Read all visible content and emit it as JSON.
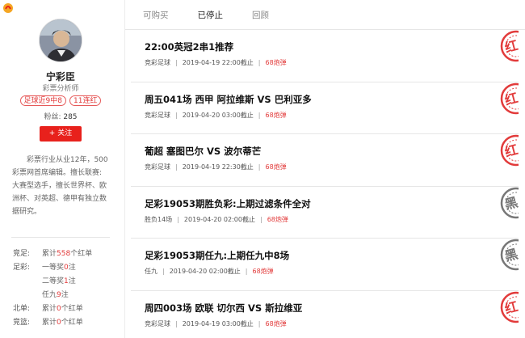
{
  "tabs": [
    {
      "label": "可购买"
    },
    {
      "label": "已停止"
    },
    {
      "label": "回顾"
    }
  ],
  "profile": {
    "name": "宁彩臣",
    "role": "彩票分析师",
    "badges": [
      "足球近9中8",
      "11连红"
    ],
    "fans_label": "粉丝:",
    "fans_count": "285",
    "follow_label": "+ 关注",
    "bio": "彩票行业从业12年，500彩票网首席编辑。擅长联赛:大赛型选手，擅长世界杯、欧洲杯、对英超、德甲有独立数据研究。"
  },
  "stats": [
    {
      "label": "竞足:",
      "text_pre": "累计 ",
      "num": "558",
      "text_post": " 个红单"
    },
    {
      "label": "足彩:",
      "text_pre": "一等奖 ",
      "num": "0",
      "text_post": " 注"
    },
    {
      "label": "",
      "text_pre": "二等奖 ",
      "num": "1",
      "text_post": " 注"
    },
    {
      "label": "",
      "text_pre": "任九 ",
      "num": "9",
      "text_post": " 注"
    },
    {
      "label": "北单:",
      "text_pre": "累计 ",
      "num": "0",
      "text_post": " 个红单"
    },
    {
      "label": "竞篮:",
      "text_pre": "累计 ",
      "num": "0",
      "text_post": " 个红单"
    }
  ],
  "colors": {
    "accent": "#e8211c",
    "red_stamp": "#e23b3b",
    "black_stamp": "#777777"
  },
  "items": [
    {
      "title": "22:00英冠2串1推荐",
      "category": "竞彩足球",
      "deadline": "2019-04-19 22:00截止",
      "price": "68炮弹",
      "result": "红"
    },
    {
      "title": "周五041场 西甲 阿拉维斯 VS 巴利亚多",
      "category": "竞彩足球",
      "deadline": "2019-04-20 03:00截止",
      "price": "68炮弹",
      "result": "红"
    },
    {
      "title": "葡超 塞图巴尔 VS 波尔蒂芒",
      "category": "竞彩足球",
      "deadline": "2019-04-19 22:30截止",
      "price": "68炮弹",
      "result": "红"
    },
    {
      "title": "足彩19053期胜负彩:上期过滤条件全对",
      "category": "胜负14场",
      "deadline": "2019-04-20 02:00截止",
      "price": "68炮弹",
      "result": "黑"
    },
    {
      "title": "足彩19053期任九:上期任九中8场",
      "category": "任九",
      "deadline": "2019-04-20 02:00截止",
      "price": "68炮弹",
      "result": "黑"
    },
    {
      "title": "周四003场 欧联 切尔西 VS 斯拉维亚",
      "category": "竞彩足球",
      "deadline": "2019-04-19 03:00截止",
      "price": "68炮弹",
      "result": "红"
    }
  ]
}
